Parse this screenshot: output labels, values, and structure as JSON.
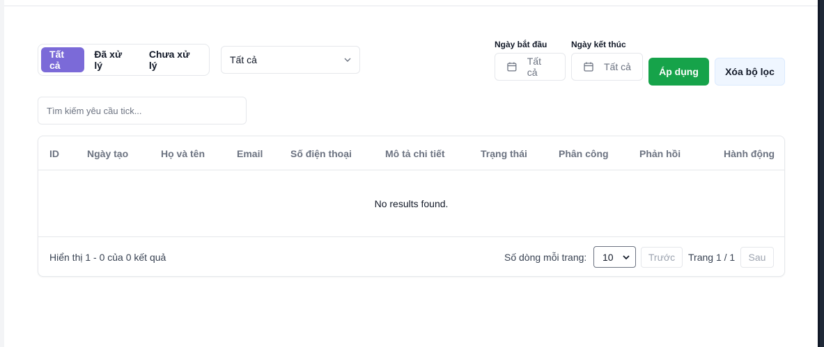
{
  "tabs": [
    {
      "label": "Tất cả",
      "active": true
    },
    {
      "label": "Đã xử lý",
      "active": false
    },
    {
      "label": "Chưa xử lý",
      "active": false
    }
  ],
  "status_select": {
    "value": "Tất cả"
  },
  "date_filters": {
    "start_label": "Ngày bắt đầu",
    "start_value": "Tất cả",
    "end_label": "Ngày kết thúc",
    "end_value": "Tất cả"
  },
  "buttons": {
    "apply": "Áp dụng",
    "clear": "Xóa bộ lọc"
  },
  "search": {
    "placeholder": "Tìm kiếm yêu cầu tick..."
  },
  "table": {
    "columns": [
      "ID",
      "Ngày tạo",
      "Họ và tên",
      "Email",
      "Số điện thoại",
      "Mô tả chi tiết",
      "Trạng thái",
      "Phân công",
      "Phản hồi",
      "Hành động"
    ],
    "empty_text": "No results found."
  },
  "footer": {
    "summary": "Hiển thị 1 - 0 của 0 kết quả",
    "rows_label": "Số dòng mỗi trang:",
    "rows_value": "10",
    "prev": "Trước",
    "page_info": "Trang 1 / 1",
    "next": "Sau"
  },
  "colors": {
    "accent": "#7b6ad8",
    "apply": "#16a34a",
    "clear_bg": "#eff6ff"
  }
}
